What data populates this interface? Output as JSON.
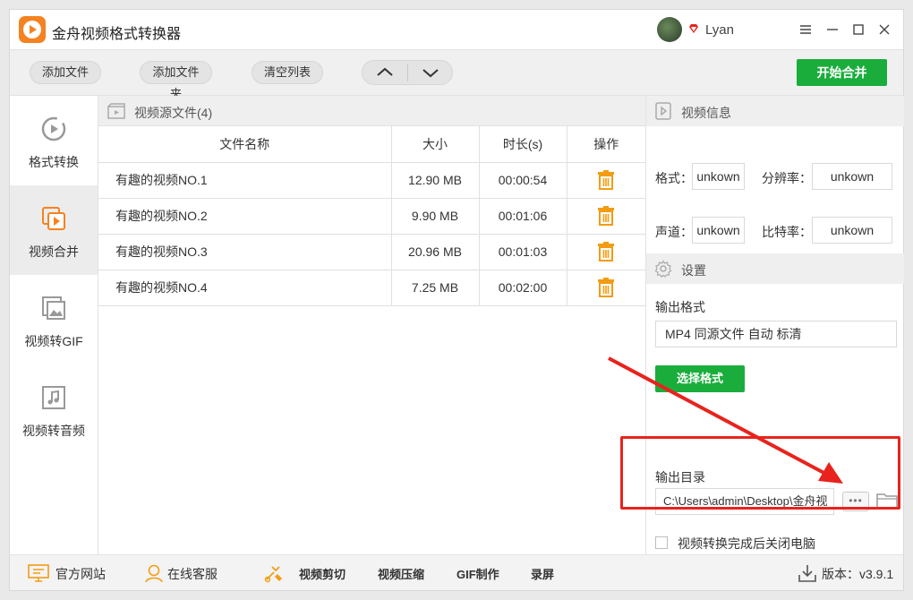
{
  "app": {
    "title": "金舟视频格式转换器",
    "username": "Lyan"
  },
  "toolbar": {
    "add_file": "添加文件",
    "add_folder": "添加文件夹",
    "clear_list": "清空列表",
    "start_merge": "开始合并"
  },
  "nav": {
    "items": [
      {
        "label": "格式转换",
        "icon": "format-convert-icon"
      },
      {
        "label": "视频合并",
        "icon": "video-merge-icon"
      },
      {
        "label": "视频转GIF",
        "icon": "image-icon"
      },
      {
        "label": "视频转音频",
        "icon": "music-note-icon"
      }
    ],
    "active_index": 1
  },
  "files": {
    "header": "视频源文件(4)",
    "columns": [
      "文件名称",
      "大小",
      "时长(s)",
      "操作"
    ],
    "rows": [
      {
        "name": "有趣的视频NO.1",
        "size": "12.90 MB",
        "duration": "00:00:54"
      },
      {
        "name": "有趣的视频NO.2",
        "size": "9.90 MB",
        "duration": "00:01:06"
      },
      {
        "name": "有趣的视频NO.3",
        "size": "20.96 MB",
        "duration": "00:01:03"
      },
      {
        "name": "有趣的视频NO.4",
        "size": "7.25 MB",
        "duration": "00:02:00"
      }
    ]
  },
  "video_info": {
    "header": "视频信息",
    "format_label": "格式：",
    "format_value": "unkown",
    "resolution_label": "分辨率：",
    "resolution_value": "unkown",
    "audio_label": "声道：",
    "audio_value": "unkown",
    "bitrate_label": "比特率：",
    "bitrate_value": "unkown"
  },
  "settings": {
    "header": "设置",
    "output_format_label": "输出格式",
    "output_format_value": "MP4 同源文件 自动 标清",
    "choose_format": "选择格式",
    "output_dir_label": "输出目录",
    "output_dir_value": "C:\\Users\\admin\\Desktop\\金舟视",
    "browse_dots": "•••",
    "shutdown_label": "视频转换完成后关闭电脑"
  },
  "bottom": {
    "website": "官方网站",
    "support": "在线客服",
    "video_cut": "视频剪切",
    "video_compress": "视频压缩",
    "gif_make": "GIF制作",
    "record": "录屏",
    "version": "版本：v3.9.1"
  },
  "colors": {
    "brand_orange": "#f58220",
    "primary_green": "#1aad3c",
    "annotation_red": "#e8231d",
    "trash_orange": "#f39c12"
  }
}
